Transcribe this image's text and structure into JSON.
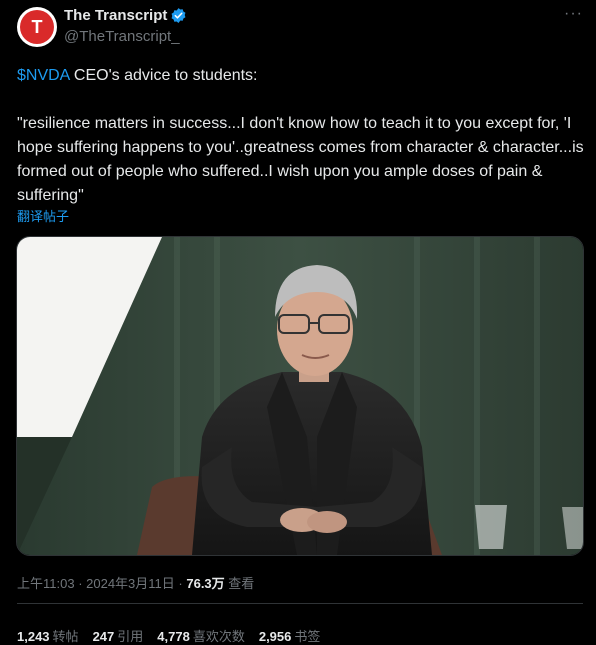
{
  "author": {
    "avatar_letter": "T",
    "display_name": "The Transcript",
    "handle": "@TheTranscript_",
    "verified": true
  },
  "tweet": {
    "cashtag": "$NVDA",
    "line1_rest": " CEO's advice to students:",
    "quote": "\"resilience matters in success...I don't know how to teach it to you except for, 'I hope suffering happens to you'..greatness comes from character & character...is formed out of people who suffered..I wish upon you ample doses of pain & suffering\"",
    "translate_label": "翻译帖子"
  },
  "meta": {
    "time": "上午11:03",
    "sep1": " · ",
    "date": "2024年3月11日",
    "sep2": " · ",
    "views": "76.3万",
    "views_label": " 查看"
  },
  "stats": [
    {
      "count": "1,243",
      "label": "转帖"
    },
    {
      "count": "247",
      "label": "引用"
    },
    {
      "count": "4,778",
      "label": "喜欢次数"
    },
    {
      "count": "2,956",
      "label": "书签"
    }
  ],
  "colors": {
    "background": "#000000",
    "text": "#e7e9ea",
    "secondary": "#71767b",
    "accent": "#1d9bf0",
    "avatar_red": "#d92a2a"
  }
}
